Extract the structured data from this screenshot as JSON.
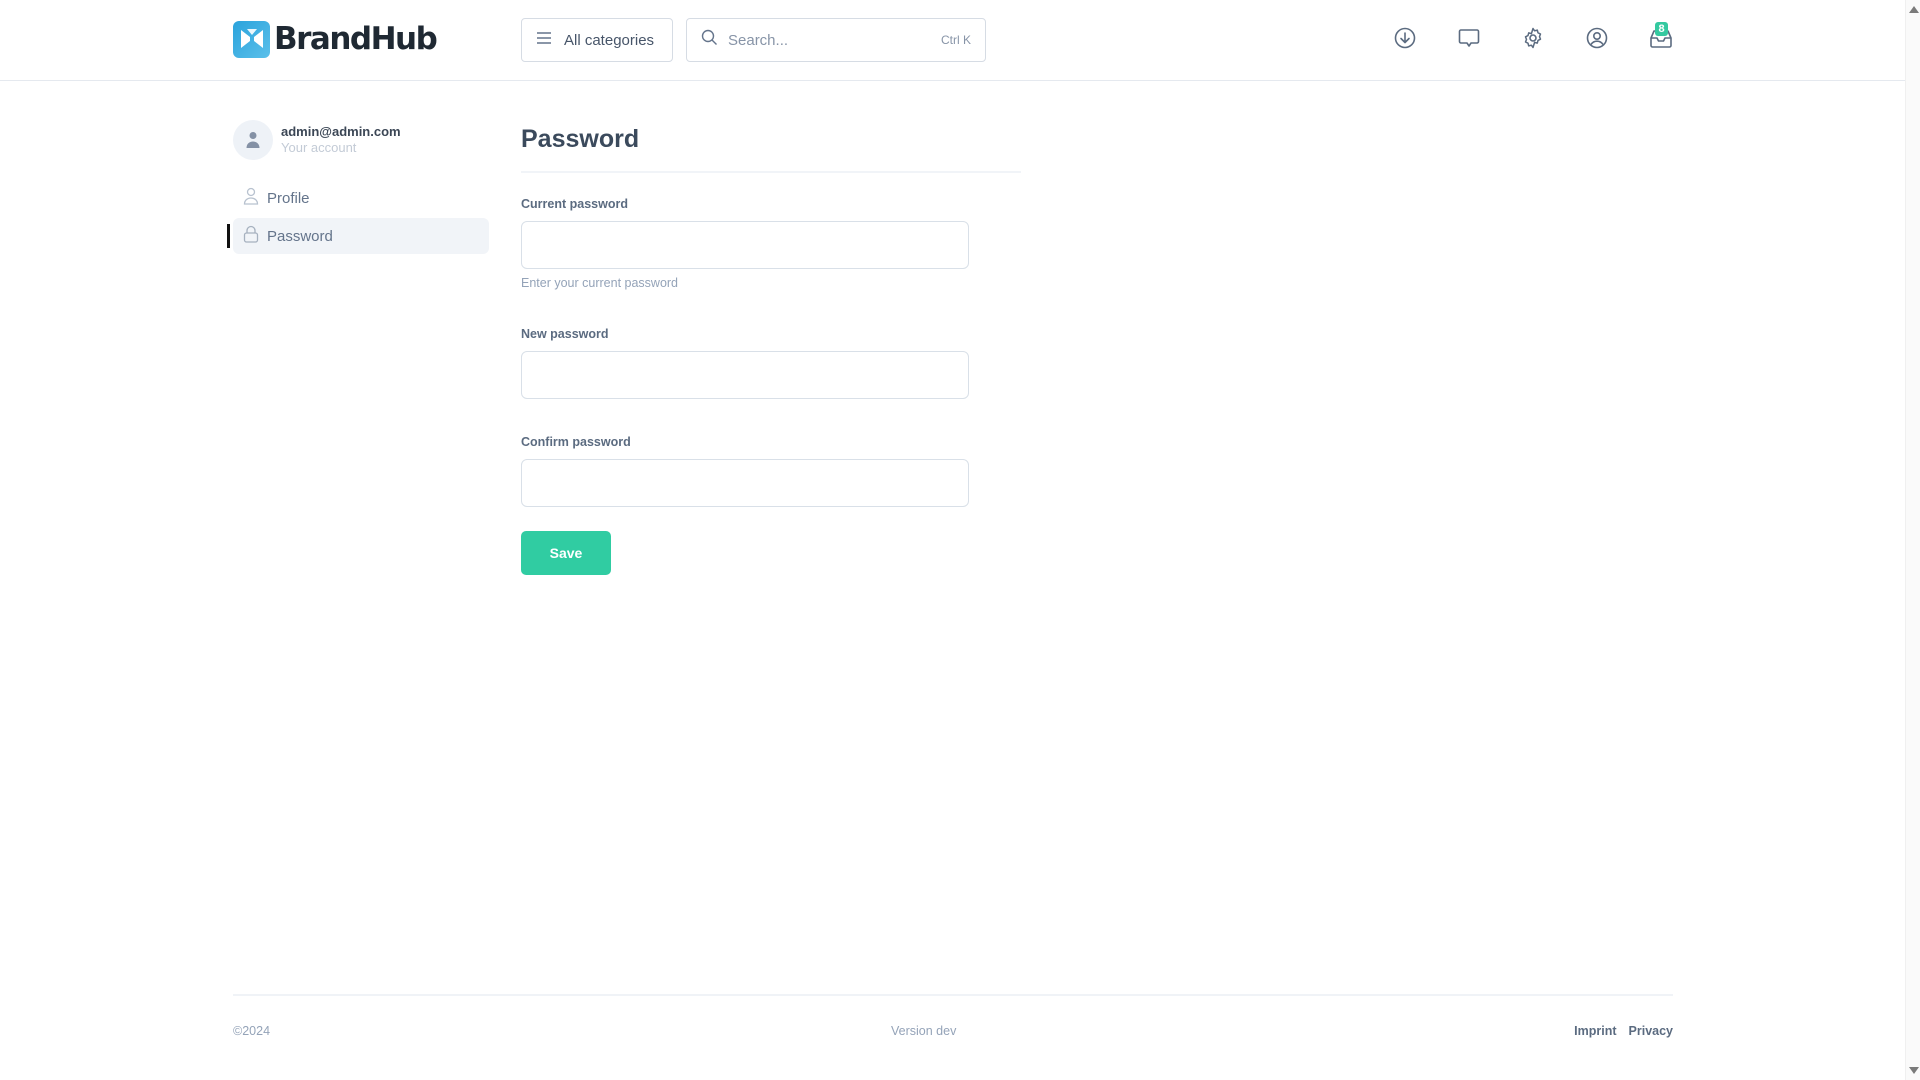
{
  "header": {
    "brand": "BrandHub",
    "categories_label": "All categories",
    "search_placeholder": "Search...",
    "search_shortcut": "Ctrl K",
    "icons": [
      "download-icon",
      "chat-icon",
      "settings-icon",
      "user-circle-icon",
      "inbox-icon"
    ],
    "inbox_badge": "8",
    "accent_color": "#34c9a0"
  },
  "sidebar": {
    "account_email": "admin@admin.com",
    "account_sub": "Your account",
    "items": [
      {
        "label": "Profile",
        "icon": "user-icon",
        "active": false
      },
      {
        "label": "Password",
        "icon": "lock-icon",
        "active": true
      }
    ]
  },
  "main": {
    "title": "Password",
    "fields": [
      {
        "label": "Current password",
        "value": "",
        "hint": "Enter your current password"
      },
      {
        "label": "New password",
        "value": ""
      },
      {
        "label": "Confirm password",
        "value": ""
      }
    ],
    "save_label": "Save",
    "save_color": "#30cca2"
  },
  "footer": {
    "copyright": "©2024",
    "version": "Version dev",
    "links": [
      "Imprint",
      "Privacy"
    ]
  }
}
